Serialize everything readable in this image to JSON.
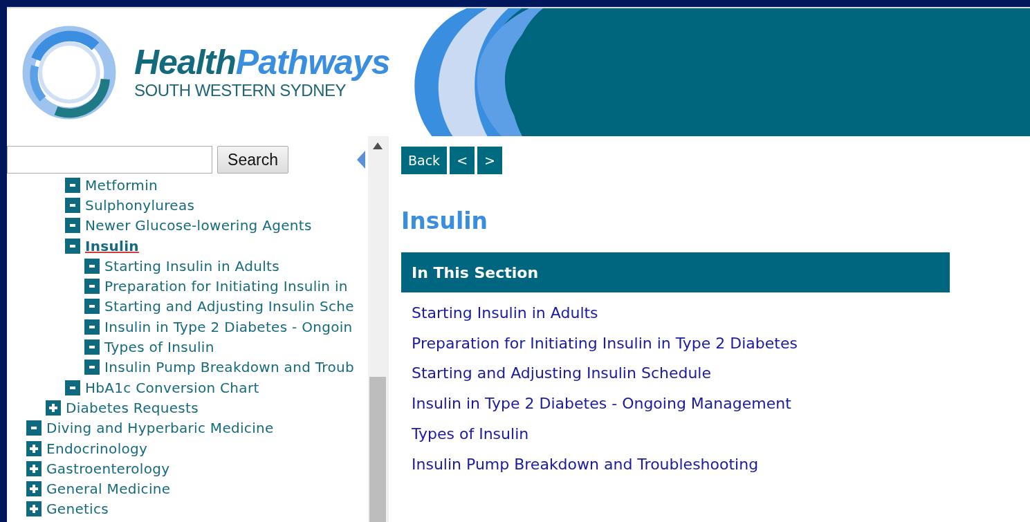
{
  "header": {
    "logo": {
      "title_parts": [
        "Health",
        "Pathways"
      ],
      "subtitle": "SOUTH WESTERN SYDNEY"
    }
  },
  "sidebar": {
    "search": {
      "button": "Search"
    },
    "tree": [
      {
        "children": [
          {
            "children": [
              {
                "label": "Metformin",
                "expanded": true,
                "selected": false
              },
              {
                "label": "Sulphonylureas",
                "expanded": true,
                "selected": false
              },
              {
                "label": "Newer Glucose-lowering Agents",
                "expanded": true,
                "selected": false
              },
              {
                "label": "Insulin",
                "expanded": true,
                "selected": true,
                "children": [
                  {
                    "label": "Starting Insulin in Adults",
                    "expanded": true,
                    "selected": false
                  },
                  {
                    "label": "Preparation for Initiating Insulin in",
                    "expanded": true,
                    "selected": false
                  },
                  {
                    "label": "Starting and Adjusting Insulin Sche",
                    "expanded": true,
                    "selected": false
                  },
                  {
                    "label": "Insulin in Type 2 Diabetes - Ongoin",
                    "expanded": true,
                    "selected": false
                  },
                  {
                    "label": "Types of Insulin",
                    "expanded": true,
                    "selected": false
                  },
                  {
                    "label": "Insulin Pump Breakdown and Troub",
                    "expanded": true,
                    "selected": false
                  }
                ]
              },
              {
                "label": "HbA1c Conversion Chart",
                "expanded": true,
                "selected": false
              }
            ]
          },
          {
            "label": "Diabetes Requests",
            "expanded": false,
            "selected": false
          }
        ]
      },
      {
        "label": "Diving and Hyperbaric Medicine",
        "expanded": true,
        "selected": false
      },
      {
        "label": "Endocrinology",
        "expanded": false,
        "selected": false
      },
      {
        "label": "Gastroenterology",
        "expanded": false,
        "selected": false
      },
      {
        "label": "General Medicine",
        "expanded": false,
        "selected": false
      },
      {
        "label": "Genetics",
        "expanded": false,
        "selected": false
      }
    ]
  },
  "content": {
    "nav_buttons": [
      "Back",
      "<",
      ">"
    ],
    "title": "Insulin",
    "section": {
      "heading": "In This Section",
      "links": [
        "Starting Insulin in Adults",
        "Preparation for Initiating Insulin in Type 2 Diabetes",
        "Starting and Adjusting Insulin Schedule",
        "Insulin in Type 2 Diabetes - Ongoing Management",
        "Types of Insulin",
        "Insulin Pump Breakdown and Troubleshooting"
      ]
    }
  }
}
